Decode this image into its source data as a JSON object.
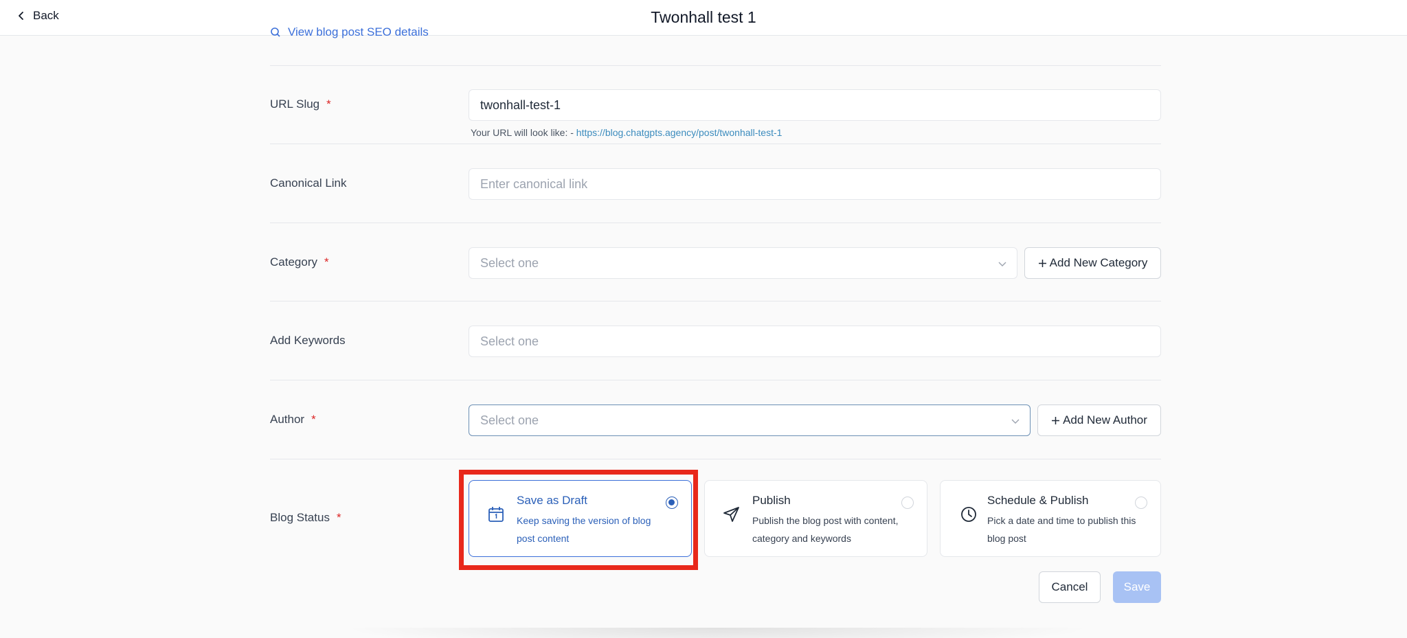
{
  "header": {
    "back_label": "Back",
    "title": "Twonhall test 1"
  },
  "seo": {
    "view_link_label": "View blog post SEO details"
  },
  "url_slug": {
    "label": "URL Slug",
    "value": "twonhall-test-1",
    "helper_prefix": "Your URL will look like: - ",
    "helper_link": "https://blog.chatgpts.agency/post/twonhall-test-1"
  },
  "canonical": {
    "label": "Canonical Link",
    "placeholder": "Enter canonical link"
  },
  "category": {
    "label": "Category",
    "placeholder": "Select one",
    "add_label": "Add New Category"
  },
  "keywords": {
    "label": "Add Keywords",
    "placeholder": "Select one"
  },
  "author": {
    "label": "Author",
    "placeholder": "Select one",
    "add_label": "Add New Author"
  },
  "blog_status": {
    "label": "Blog Status",
    "options": [
      {
        "title": "Save as Draft",
        "desc": "Keep saving the version of blog post content",
        "selected": true,
        "icon": "calendar-icon"
      },
      {
        "title": "Publish",
        "desc": "Publish the blog post with content, category and keywords",
        "selected": false,
        "icon": "send-icon"
      },
      {
        "title": "Schedule & Publish",
        "desc": "Pick a date and time to publish this blog post",
        "selected": false,
        "icon": "clock-icon"
      }
    ]
  },
  "actions": {
    "cancel_label": "Cancel",
    "save_label": "Save"
  },
  "required_mark": "*",
  "colors": {
    "accent": "#2a5fb8",
    "required": "#dc2626",
    "highlight": "#e8281b",
    "save_disabled": "#a8c2f4",
    "link": "#3b8bbd"
  }
}
